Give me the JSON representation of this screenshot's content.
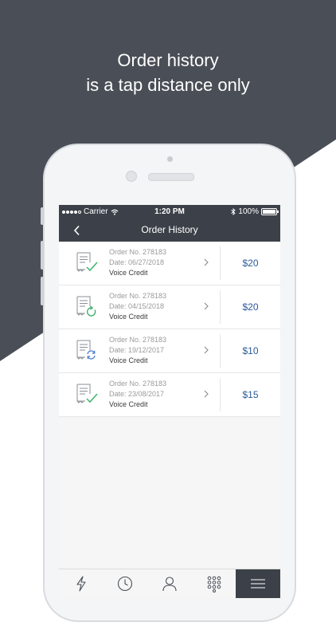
{
  "headline": {
    "line1": "Order history",
    "line2": "is a tap distance only"
  },
  "colors": {
    "background_dark": "#4a4f57",
    "navbar": "#3c4149",
    "amount": "#2a5a9a",
    "check_green": "#3db36b",
    "refresh_green": "#3db36b",
    "sync_blue": "#4a7bd0"
  },
  "status_bar": {
    "carrier": "Carrier",
    "time": "1:20 PM",
    "battery": "100%"
  },
  "nav": {
    "title": "Order History",
    "back_icon": "chevron-left-icon"
  },
  "orders": [
    {
      "order_no": "Order No. 278183",
      "date": "Date: 06/27/2018",
      "type": "Voice Credit",
      "amount": "$20",
      "status_icon": "receipt-check-icon"
    },
    {
      "order_no": "Order No. 278183",
      "date": "Date: 04/15/2018",
      "type": "Voice Credit",
      "amount": "$20",
      "status_icon": "receipt-refresh-icon"
    },
    {
      "order_no": "Order No. 278183",
      "date": "Date: 19/12/2017",
      "type": "Voice Credit",
      "amount": "$10",
      "status_icon": "receipt-sync-icon"
    },
    {
      "order_no": "Order No. 278183",
      "date": "Date: 23/08/2017",
      "type": "Voice Credit",
      "amount": "$15",
      "status_icon": "receipt-check-icon"
    }
  ],
  "tabs": [
    {
      "icon": "lightning-icon",
      "active": false
    },
    {
      "icon": "clock-icon",
      "active": false
    },
    {
      "icon": "user-icon",
      "active": false
    },
    {
      "icon": "dialpad-icon",
      "active": false
    },
    {
      "icon": "menu-icon",
      "active": true
    }
  ]
}
